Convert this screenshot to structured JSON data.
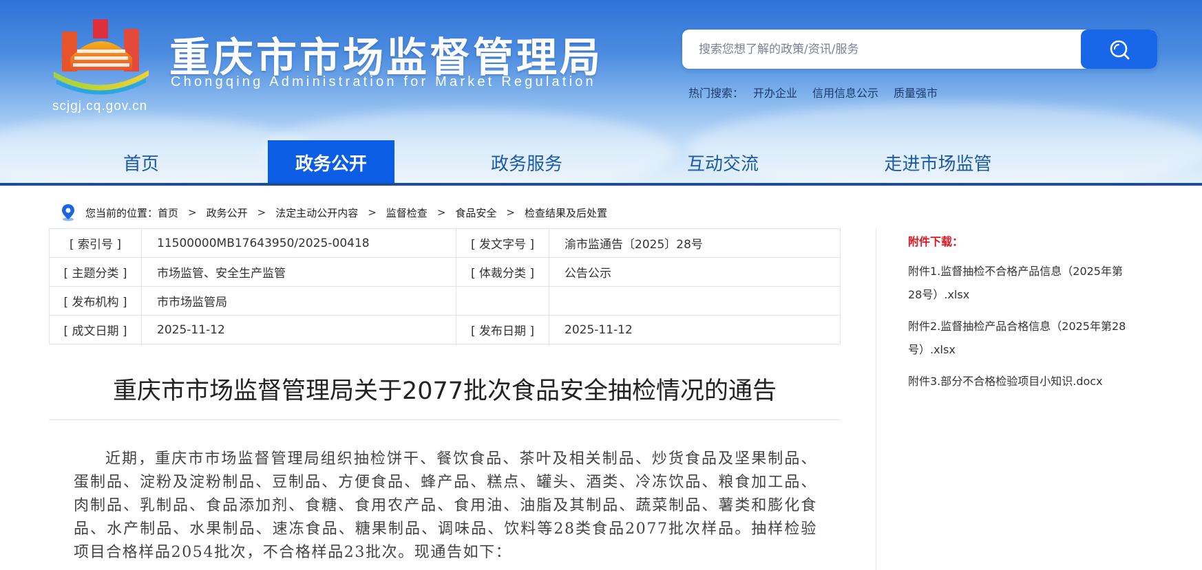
{
  "site": {
    "title": "重庆市市场监督管理局",
    "subtitle": "Chongqing  Administration for Market Regulation",
    "domain": "scjgj.cq.gov.cn"
  },
  "search": {
    "placeholder": "搜索您想了解的政策/资讯/服务",
    "hot_label": "热门搜索：",
    "hot_links": [
      "开办企业",
      "信用信息公示",
      "质量强市"
    ]
  },
  "nav": {
    "items": [
      "首页",
      "政务公开",
      "政务服务",
      "互动交流",
      "走进市场监管"
    ],
    "active": "政务公开"
  },
  "breadcrumb": {
    "prefix": "您当前的位置：",
    "items": [
      "首页",
      "政务公开",
      "法定主动公开内容",
      "监督检查",
      "食品安全",
      "检查结果及后处置"
    ],
    "sep": ">"
  },
  "meta": {
    "rows": [
      {
        "k1": "[ 索引号 ]",
        "v1": "11500000MB17643950/2025-00418",
        "k2": "[ 发文字号 ]",
        "v2": "渝市监通告〔2025〕28号"
      },
      {
        "k1": "[ 主题分类 ]",
        "v1": "市场监管、安全生产监管",
        "k2": "[ 体裁分类 ]",
        "v2": "公告公示"
      },
      {
        "k1": "[ 发布机构 ]",
        "v1": "市市场监管局",
        "k2": "",
        "v2": ""
      },
      {
        "k1": "[ 成文日期 ]",
        "v1": "2025-11-12",
        "k2": "[ 发布日期 ]",
        "v2": "2025-11-12"
      }
    ]
  },
  "article": {
    "title": "重庆市市场监督管理局关于2077批次食品安全抽检情况的通告",
    "body": "近期，重庆市市场监督管理局组织抽检饼干、餐饮食品、茶叶及相关制品、炒货食品及坚果制品、蛋制品、淀粉及淀粉制品、豆制品、方便食品、蜂产品、糕点、罐头、酒类、冷冻饮品、粮食加工品、肉制品、乳制品、食品添加剂、食糖、食用农产品、食用油、油脂及其制品、蔬菜制品、薯类和膨化食品、水产制品、水果制品、速冻食品、糖果制品、调味品、饮料等28类食品2077批次样品。抽样检验项目合格样品2054批次，不合格样品23批次。现通告如下："
  },
  "attachments": {
    "title": "附件下载：",
    "items": [
      "附件1.监督抽检不合格产品信息（2025年第28号）.xlsx",
      "附件2.监督抽检产品合格信息（2025年第28号）.xlsx",
      "附件3.部分不合格检验项目小知识.docx"
    ]
  },
  "colors": {
    "nav_active_bg": "#0c5de6",
    "nav_active_underline": "#e60012",
    "search_button": "#1767e8",
    "attachment_title": "#e0141e"
  }
}
